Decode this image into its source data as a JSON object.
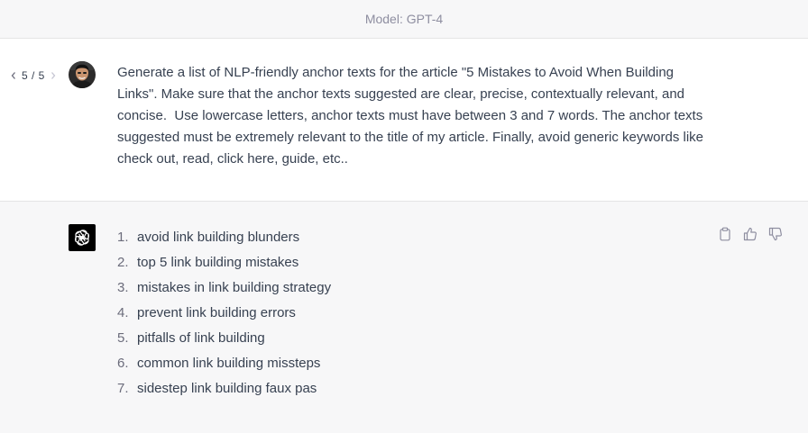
{
  "header": {
    "model_label": "Model: GPT-4"
  },
  "user_message": {
    "pager": {
      "prev_icon": "chevron-left-icon",
      "count": "5 / 5",
      "next_icon": "chevron-right-icon"
    },
    "avatar_icon": "user-avatar",
    "text": "Generate a list of NLP-friendly anchor texts for the article \"5 Mistakes to Avoid When Building Links\". Make sure that the anchor texts suggested are clear, precise, contextually relevant, and concise.  Use lowercase letters, anchor texts must have between 3 and 7 words. The anchor texts suggested must be extremely relevant to the title of my article. Finally, avoid generic keywords like check out, read, click here, guide, etc.."
  },
  "assistant_message": {
    "logo_icon": "openai-logo-icon",
    "items": [
      {
        "num": "1.",
        "text": "avoid link building blunders"
      },
      {
        "num": "2.",
        "text": "top 5 link building mistakes"
      },
      {
        "num": "3.",
        "text": "mistakes in link building strategy"
      },
      {
        "num": "4.",
        "text": "prevent link building errors"
      },
      {
        "num": "5.",
        "text": "pitfalls of link building"
      },
      {
        "num": "6.",
        "text": "common link building missteps"
      },
      {
        "num": "7.",
        "text": "sidestep link building faux pas"
      }
    ],
    "actions": [
      "clipboard-icon",
      "thumbs-up-icon",
      "thumbs-down-icon"
    ]
  },
  "colors": {
    "background": "#f7f7f8",
    "user_background": "#ffffff",
    "text": "#374151",
    "muted": "#8e8ea0",
    "logo_bg": "#000000"
  }
}
